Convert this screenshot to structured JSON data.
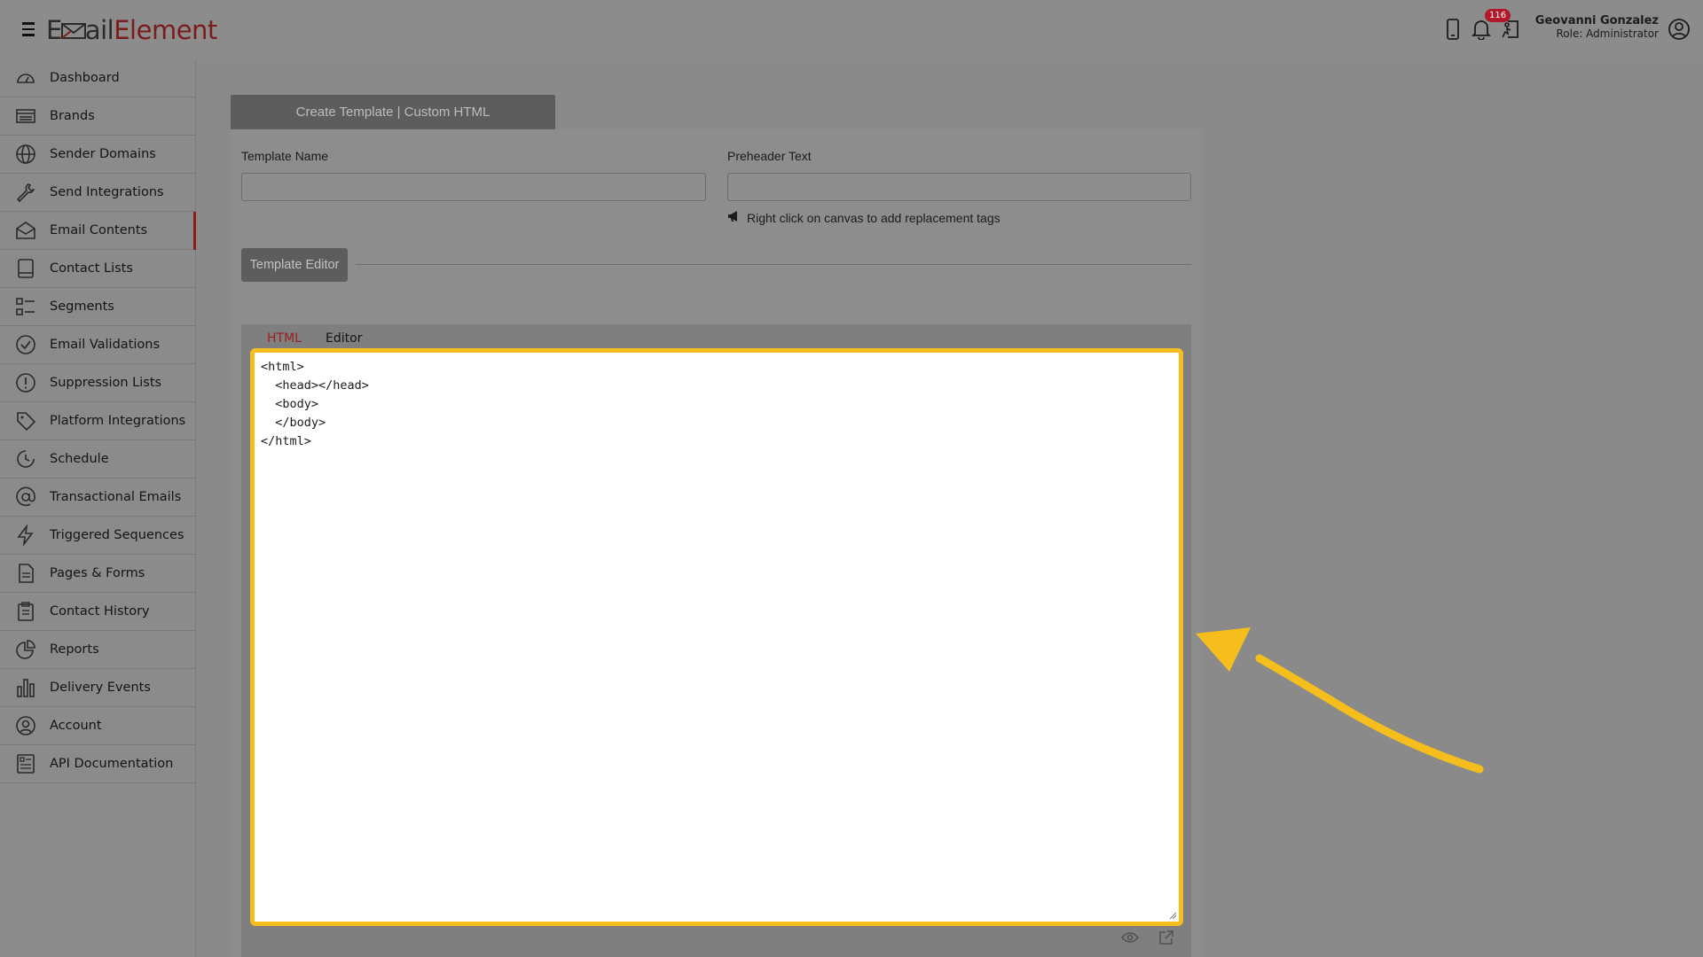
{
  "header": {
    "logo_prefix": "E",
    "logo_mid": "ail",
    "logo_brand": "Element",
    "notification_count": "116",
    "user_name": "Geovanni Gonzalez",
    "user_role": "Role: Administrator"
  },
  "sidebar": {
    "items": [
      {
        "label": "Dashboard",
        "icon": "gauge-icon"
      },
      {
        "label": "Brands",
        "icon": "brand-card-icon"
      },
      {
        "label": "Sender Domains",
        "icon": "globe-icon"
      },
      {
        "label": "Send Integrations",
        "icon": "wrench-icon"
      },
      {
        "label": "Email Contents",
        "icon": "envelope-open-icon",
        "active": true
      },
      {
        "label": "Contact Lists",
        "icon": "book-icon"
      },
      {
        "label": "Segments",
        "icon": "segments-icon"
      },
      {
        "label": "Email Validations",
        "icon": "check-circle-icon"
      },
      {
        "label": "Suppression Lists",
        "icon": "exclamation-circle-icon"
      },
      {
        "label": "Platform Integrations",
        "icon": "tag-icon"
      },
      {
        "label": "Schedule",
        "icon": "clock-icon"
      },
      {
        "label": "Transactional Emails",
        "icon": "at-icon"
      },
      {
        "label": "Triggered Sequences",
        "icon": "lightning-icon"
      },
      {
        "label": "Pages & Forms",
        "icon": "page-icon"
      },
      {
        "label": "Contact History",
        "icon": "clipboard-icon"
      },
      {
        "label": "Reports",
        "icon": "pie-chart-icon"
      },
      {
        "label": "Delivery Events",
        "icon": "bar-chart-icon"
      },
      {
        "label": "Account",
        "icon": "user-circle-icon"
      },
      {
        "label": "API Documentation",
        "icon": "document-list-icon"
      }
    ]
  },
  "main": {
    "card_title": "Create Template | Custom HTML",
    "template_name_label": "Template Name",
    "template_name_value": "",
    "preheader_label": "Preheader Text",
    "preheader_value": "",
    "hint_text": "Right click on canvas to add replacement tags",
    "template_editor_button": "Template Editor",
    "tabs": [
      {
        "label": "HTML",
        "active": true
      },
      {
        "label": "Editor",
        "active": false
      }
    ],
    "code_lines": [
      "<html>",
      "  <head></head>",
      "  <body>",
      "  </body>",
      "</html>"
    ]
  },
  "colors": {
    "accent_red": "#9b1c1c",
    "highlight_yellow": "#f6be1c",
    "badge_red": "#b1182a"
  }
}
